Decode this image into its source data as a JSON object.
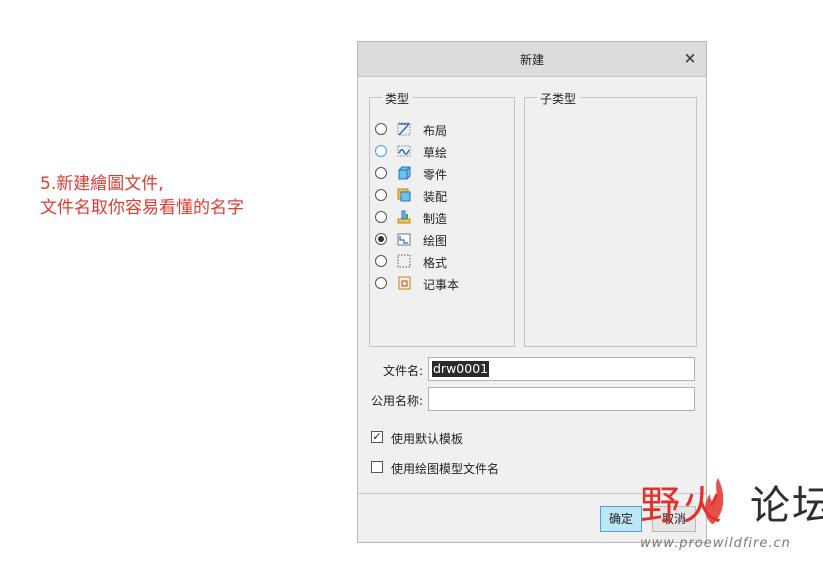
{
  "annotation": {
    "line1": "5.新建繪圖文件,",
    "line2": "文件名取你容易看懂的名字",
    "color": "#e03a32"
  },
  "dialog": {
    "title": "新建",
    "close_glyph": "×",
    "type_group": {
      "legend": "类型",
      "items": [
        {
          "label": "布局",
          "icon": "layout-icon",
          "checked": false
        },
        {
          "label": "草绘",
          "icon": "sketch-icon",
          "checked": false
        },
        {
          "label": "零件",
          "icon": "part-icon",
          "checked": false
        },
        {
          "label": "装配",
          "icon": "assembly-icon",
          "checked": false
        },
        {
          "label": "制造",
          "icon": "manufacturing-icon",
          "checked": false
        },
        {
          "label": "绘图",
          "icon": "drawing-icon",
          "checked": true
        },
        {
          "label": "格式",
          "icon": "format-icon",
          "checked": false
        },
        {
          "label": "记事本",
          "icon": "notebook-icon",
          "checked": false
        }
      ]
    },
    "subtype_group": {
      "legend": "子类型"
    },
    "file_name": {
      "label": "文件名:",
      "value": "drw0001"
    },
    "common_name": {
      "label": "公用名称:",
      "value": ""
    },
    "use_default_template": {
      "label": "使用默认模板",
      "checked": true,
      "glyph": "✓"
    },
    "use_model_filename": {
      "label": "使用绘图模型文件名",
      "checked": false
    },
    "ok_label": "确定",
    "cancel_label": "取消"
  },
  "watermark": {
    "text_red": "野火",
    "text_dark": "论坛",
    "url": "www.proewildfire.cn"
  }
}
